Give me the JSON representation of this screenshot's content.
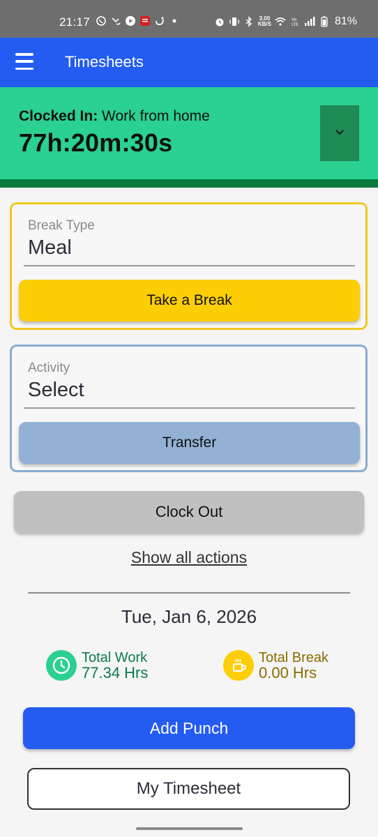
{
  "status_bar": {
    "time": "21:17",
    "net_speed_top": "3.00",
    "net_speed_bottom": "KB/S",
    "battery": "81%"
  },
  "app_bar": {
    "title": "Timesheets"
  },
  "clock": {
    "status_label": "Clocked In:",
    "status_value": "Work from home",
    "timer": "77h:20m:30s"
  },
  "break_card": {
    "label": "Break Type",
    "value": "Meal",
    "button": "Take a Break"
  },
  "activity_card": {
    "label": "Activity",
    "value": "Select",
    "button": "Transfer"
  },
  "actions": {
    "clock_out": "Clock Out",
    "show_all": "Show all actions"
  },
  "summary": {
    "date": "Tue, Jan 6, 2026",
    "total_work_label": "Total Work",
    "total_work_value": "77.34 Hrs",
    "total_break_label": "Total Break",
    "total_break_value": "0.00 Hrs"
  },
  "buttons": {
    "add_punch": "Add Punch",
    "my_timesheet": "My Timesheet"
  },
  "colors": {
    "primary": "#245cf2",
    "clocked_in": "#2ad191",
    "break": "#fdcd05",
    "transfer": "#93b1d5"
  }
}
